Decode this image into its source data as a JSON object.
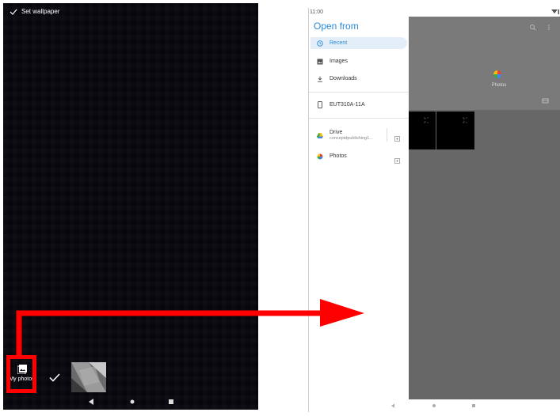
{
  "left_phone": {
    "top_bar_label": "Set wallpaper",
    "my_photos_label": "My photos",
    "icons": [
      "check-icon",
      "image-icon",
      "back-icon",
      "home-icon",
      "recents-icon"
    ]
  },
  "right_phone": {
    "status_time": "11:00",
    "drawer_title": "Open from",
    "items": [
      {
        "label": "Recent",
        "icon": "clock-icon"
      },
      {
        "label": "Images",
        "icon": "image-icon"
      },
      {
        "label": "Downloads",
        "icon": "download-icon"
      },
      {
        "label": "EUT310A-11A",
        "icon": "tablet-icon"
      },
      {
        "label": "Drive",
        "sublabel": "conceptdpublishing1...",
        "icon": "drive-icon"
      },
      {
        "label": "Photos",
        "icon": "photos-icon"
      }
    ],
    "content_title": "Photos",
    "accent": "#2a8ad6"
  },
  "annotation": {
    "color": "#ff0000"
  }
}
